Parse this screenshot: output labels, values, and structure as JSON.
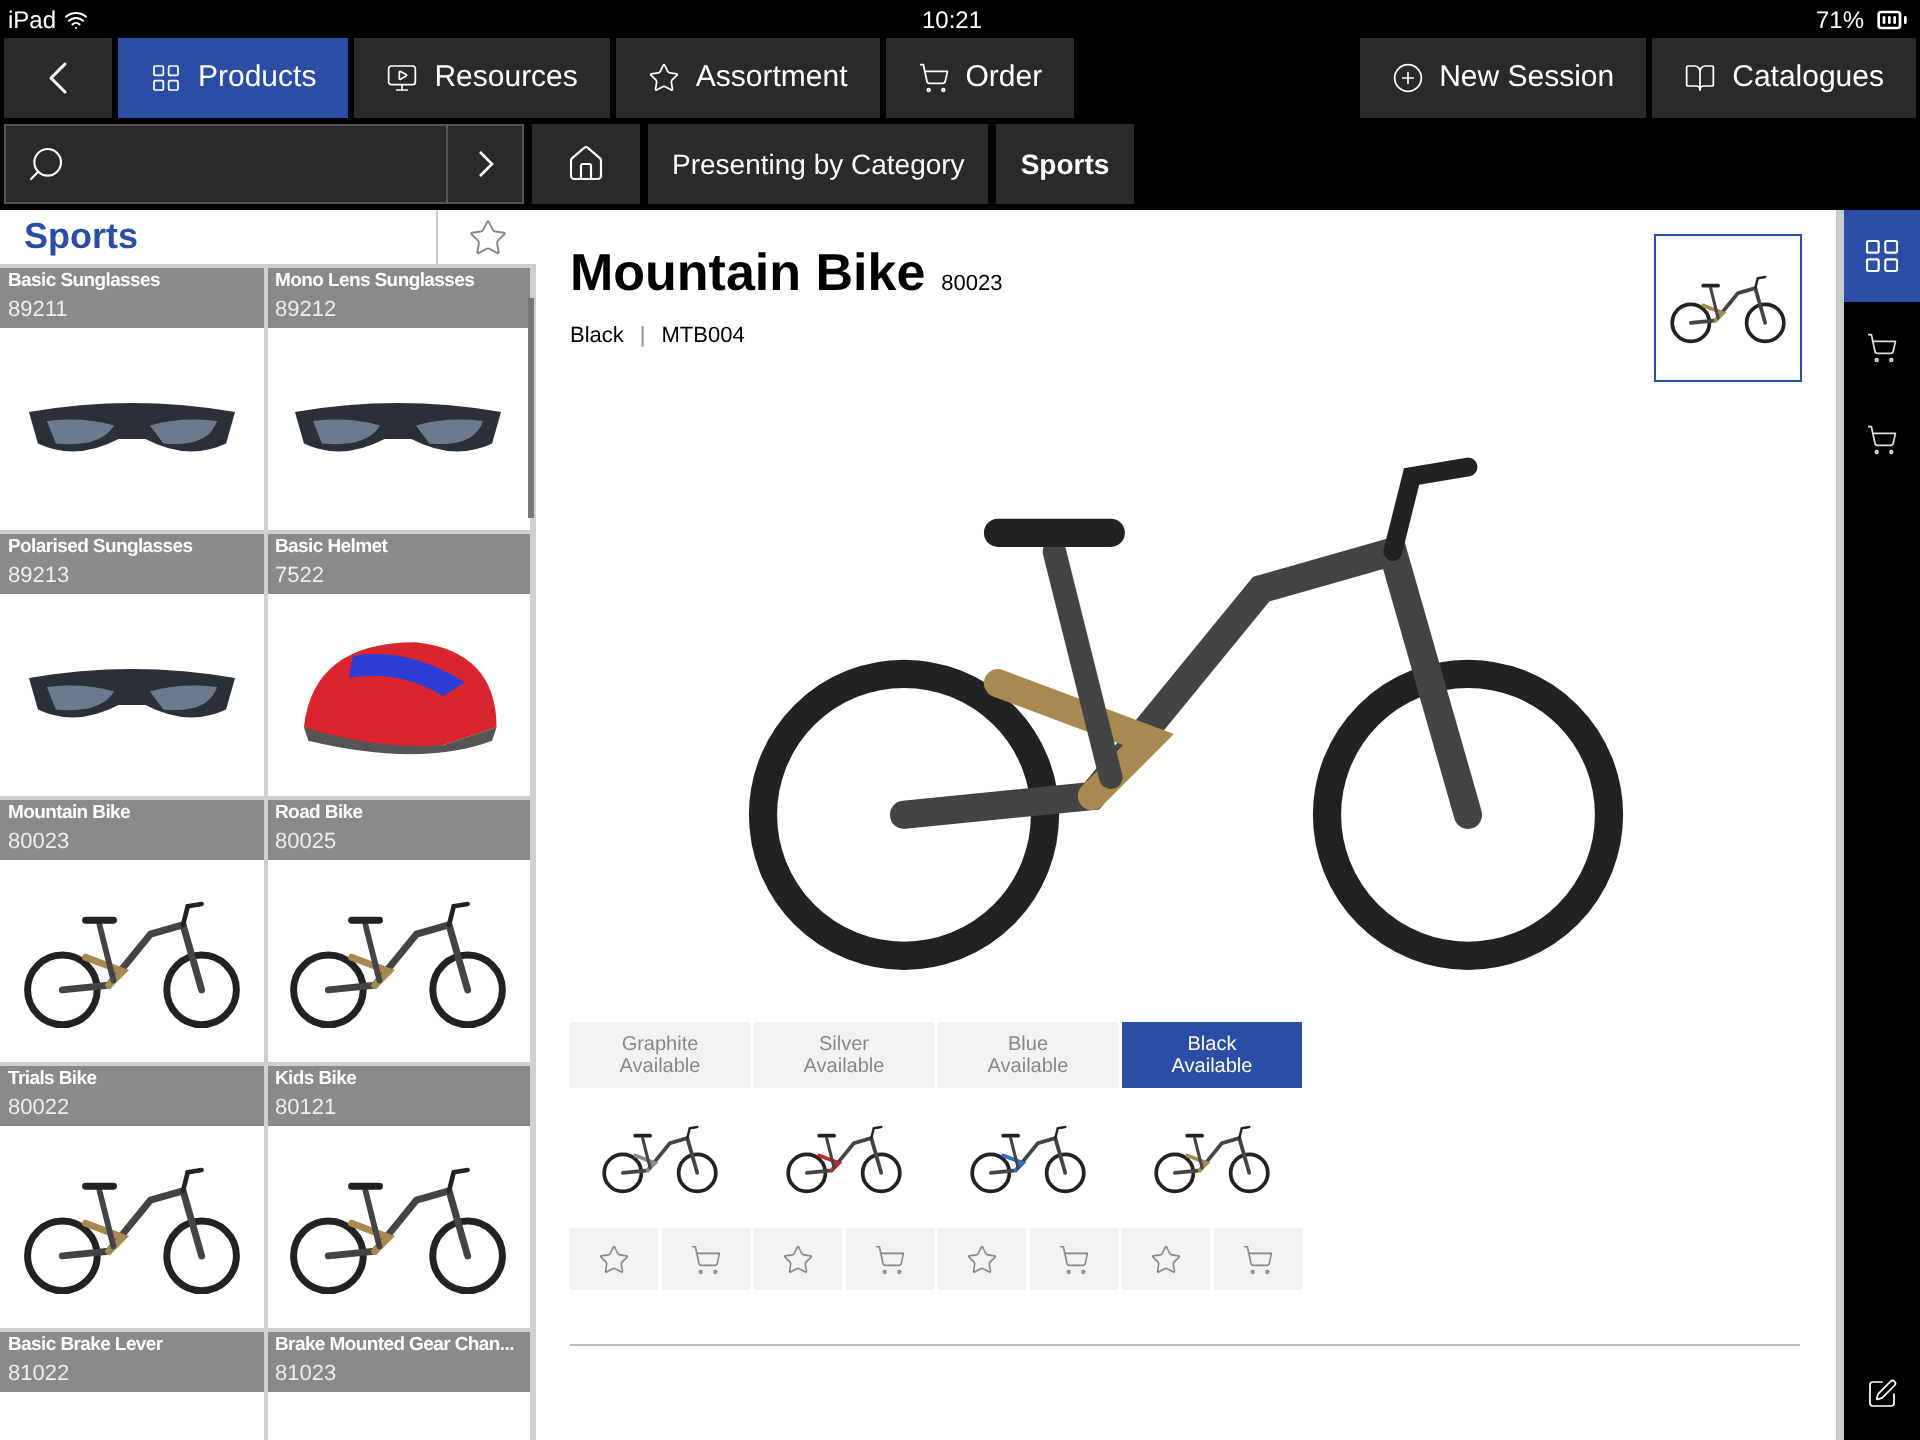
{
  "status_bar": {
    "device": "iPad",
    "time": "10:21",
    "battery": "71%"
  },
  "nav_tabs": [
    {
      "label": "Products",
      "selected": true
    },
    {
      "label": "Resources",
      "selected": false
    },
    {
      "label": "Assortment",
      "selected": false
    },
    {
      "label": "Order",
      "selected": false
    }
  ],
  "nav_actions": [
    {
      "label": "New Session"
    },
    {
      "label": "Catalogues"
    }
  ],
  "breadcrumb": [
    {
      "label": "Presenting by Category",
      "current": false
    },
    {
      "label": "Sports",
      "current": true
    }
  ],
  "category": {
    "title": "Sports"
  },
  "products": [
    {
      "name": "Basic Sunglasses",
      "code": "89211",
      "kind": "glasses"
    },
    {
      "name": "Mono Lens Sunglasses",
      "code": "89212",
      "kind": "glasses"
    },
    {
      "name": "Polarised Sunglasses",
      "code": "89213",
      "kind": "glasses"
    },
    {
      "name": "Basic Helmet",
      "code": "7522",
      "kind": "helmet"
    },
    {
      "name": "Mountain Bike",
      "code": "80023",
      "kind": "bike"
    },
    {
      "name": "Road Bike",
      "code": "80025",
      "kind": "bike"
    },
    {
      "name": "Trials Bike",
      "code": "80022",
      "kind": "bike"
    },
    {
      "name": "Kids Bike",
      "code": "80121",
      "kind": "bike"
    },
    {
      "name": "Basic Brake Lever",
      "code": "81022",
      "kind": "none"
    },
    {
      "name": "Brake Mounted Gear Chan...",
      "code": "81023",
      "kind": "none"
    }
  ],
  "detail": {
    "title": "Mountain Bike",
    "code": "80023",
    "colour": "Black",
    "separator": "|",
    "sku": "MTB004"
  },
  "variants": [
    {
      "name": "Graphite",
      "availability": "Available",
      "selected": false,
      "color": "#8a8a8a"
    },
    {
      "name": "Silver",
      "availability": "Available",
      "selected": false,
      "color": "#c0282d"
    },
    {
      "name": "Blue",
      "availability": "Available",
      "selected": false,
      "color": "#2a6fc0"
    },
    {
      "name": "Black",
      "availability": "Available",
      "selected": true,
      "color": "#a8894f"
    }
  ],
  "side_rail": [
    {
      "selected": true
    },
    {
      "selected": false
    },
    {
      "selected": false
    }
  ]
}
